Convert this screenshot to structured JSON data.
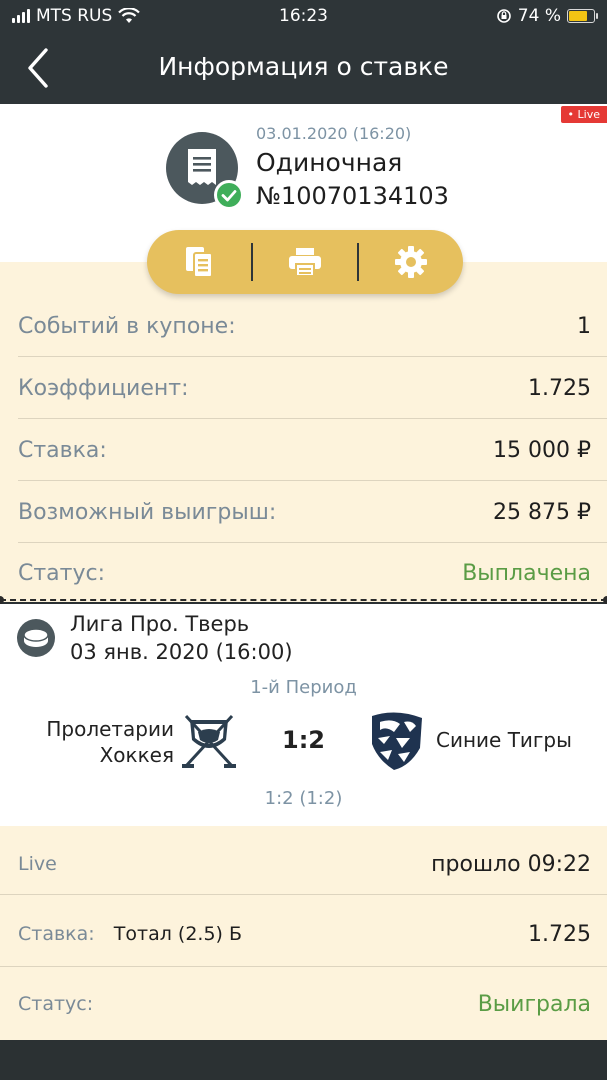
{
  "status_bar": {
    "carrier": "MTS RUS",
    "time": "16:23",
    "battery": "74 %"
  },
  "header": {
    "title": "Информация о ставке"
  },
  "bet": {
    "live_badge": "• Live",
    "datetime": "03.01.2020 (16:20)",
    "type": "Одиночная",
    "number": "№10070134103"
  },
  "details": [
    {
      "label": "Событий в купоне:",
      "value": "1"
    },
    {
      "label": "Коэффициент:",
      "value": "1.725"
    },
    {
      "label": "Ставка:",
      "value": "15 000 ₽"
    },
    {
      "label": "Возможный выигрыш:",
      "value": "25 875 ₽"
    },
    {
      "label": "Статус:",
      "value": "Выплачена"
    }
  ],
  "event": {
    "league": "Лига Про. Тверь",
    "date": "03 янв. 2020 (16:00)",
    "period": "1-й Период",
    "team1_line1": "Пролетарии",
    "team1_line2": "Хоккея",
    "score": "1:2",
    "team2": "Синие Тигры",
    "subscore": "1:2 (1:2)"
  },
  "event_details": {
    "live_label": "Live",
    "live_value": "прошло 09:22",
    "bet_label": "Ставка:",
    "bet_selection": "Тотал (2.5) Б",
    "bet_odds": "1.725",
    "status_label": "Статус:",
    "status_value": "Выиграла"
  },
  "colors": {
    "header_bg": "#2e3538",
    "accent_yellow": "#e6c05e",
    "cream_bg": "#fdf3dc",
    "status_green": "#5a9c45",
    "live_red": "#e53935"
  }
}
